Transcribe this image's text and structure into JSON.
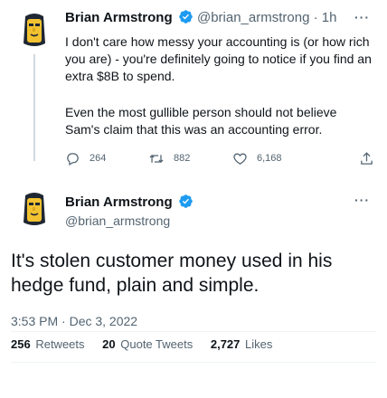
{
  "reply_tweet": {
    "display_name": "Brian Armstrong",
    "handle": "@brian_armstrong",
    "separator": "·",
    "time": "1h",
    "paragraph_1": "I don't care how messy your accounting is (or how rich you are) - you're definitely going to notice if you find an extra $8B to spend.",
    "paragraph_2": "Even the most gullible person should not believe Sam's claim that this was an accounting error.",
    "replies": "264",
    "retweets": "882",
    "likes": "6,168"
  },
  "main_tweet": {
    "display_name": "Brian Armstrong",
    "handle": "@brian_armstrong",
    "text": "It's stolen customer money used in his hedge fund, plain and simple.",
    "timestamp": "3:53 PM · Dec 3, 2022",
    "stats": {
      "retweets_count": "256",
      "retweets_label": "Retweets",
      "quote_count": "20",
      "quote_label": "Quote Tweets",
      "likes_count": "2,727",
      "likes_label": "Likes"
    }
  },
  "colors": {
    "verified": "#1d9bf0",
    "secondary_text": "#536471",
    "primary_text": "#0f1419",
    "avatar_bg": "#f2c230"
  },
  "icons": {
    "verified": "verified-badge-icon",
    "reply": "reply-icon",
    "retweet": "retweet-icon",
    "like": "heart-icon",
    "share": "share-icon",
    "more": "more-dots-icon"
  }
}
